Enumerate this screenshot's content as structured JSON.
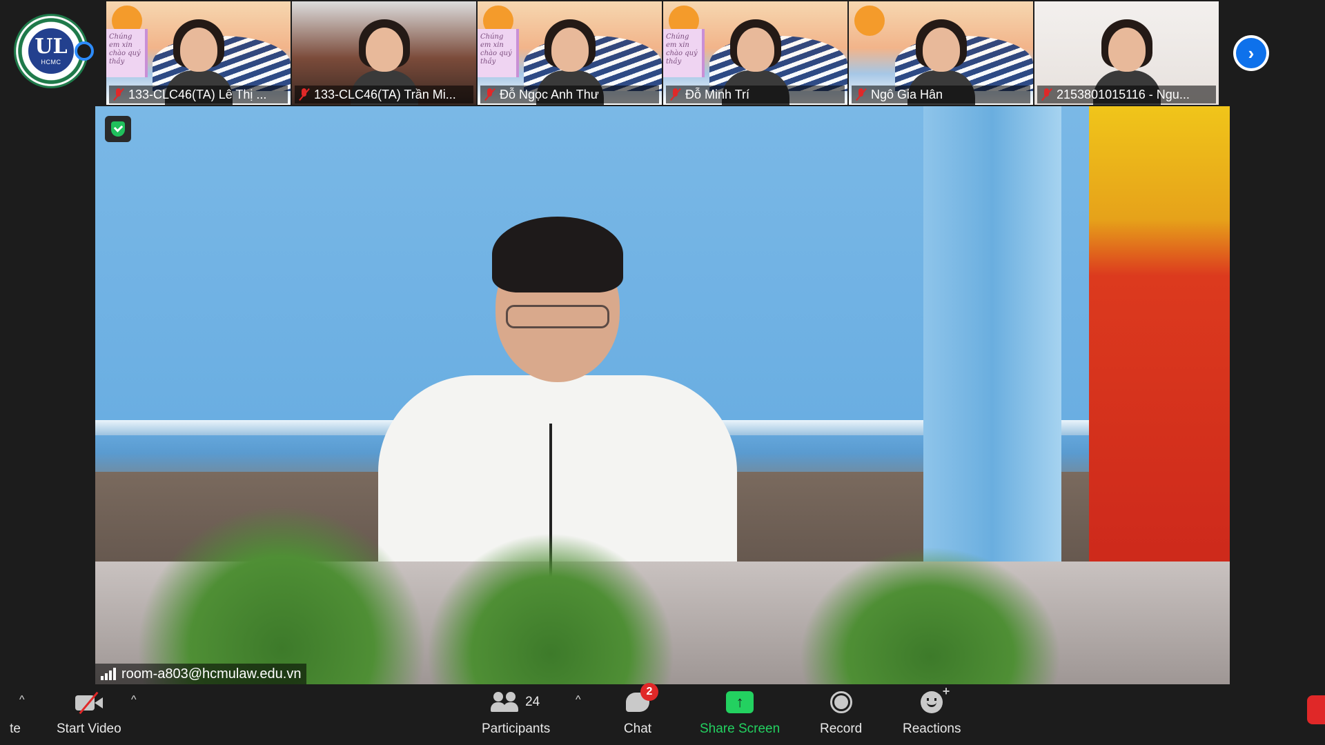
{
  "logo": {
    "mark": "UL",
    "text": "HCMC"
  },
  "gallery": {
    "tiles": [
      {
        "name": "133-CLC46(TA) Lê Thị ...",
        "card_text": "Chúng em xin chào quý thầy",
        "style": "art"
      },
      {
        "name": "133-CLC46(TA) Trần Mi...",
        "card_text": "",
        "style": "room"
      },
      {
        "name": "Đỗ Ngọc Anh Thư",
        "card_text": "Chúng em xin chào quý thầy",
        "style": "art"
      },
      {
        "name": "Đỗ Minh Trí",
        "card_text": "Chúng em xin chào quý thầy",
        "style": "art"
      },
      {
        "name": "Ngô Gia Hân",
        "card_text": "",
        "style": "art"
      },
      {
        "name": "2153801015116 - Ngu...",
        "card_text": "",
        "style": "white"
      }
    ],
    "next_icon": "chevron-right-icon"
  },
  "main_video": {
    "room_label": "room-a803@hcmulaw.edu.vn",
    "security_icon": "shield-check-icon"
  },
  "toolbar": {
    "partial_left_label": "te",
    "start_video_label": "Start Video",
    "participants_label": "Participants",
    "participants_count": "24",
    "chat_label": "Chat",
    "chat_badge": "2",
    "share_screen_label": "Share Screen",
    "record_label": "Record",
    "reactions_label": "Reactions",
    "caret": "^"
  },
  "colors": {
    "accent_blue": "#0e71eb",
    "share_green": "#23d160",
    "muted_red": "#e02828",
    "toolbar_bg": "#1c1c1c"
  }
}
